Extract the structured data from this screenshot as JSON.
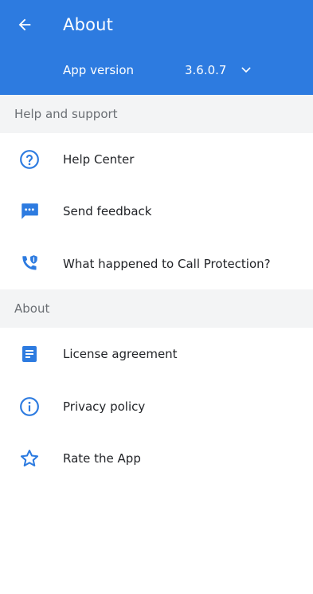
{
  "header": {
    "title": "About",
    "app_version_label": "App version",
    "app_version_value": "3.6.0.7"
  },
  "sections": [
    {
      "title": "Help and support",
      "items": [
        {
          "label": "Help Center",
          "icon": "help-circle-icon"
        },
        {
          "label": "Send feedback",
          "icon": "feedback-chat-icon"
        },
        {
          "label": "What happened to Call Protection?",
          "icon": "call-protection-icon"
        }
      ]
    },
    {
      "title": "About",
      "items": [
        {
          "label": "License agreement",
          "icon": "document-icon"
        },
        {
          "label": "Privacy policy",
          "icon": "info-icon"
        },
        {
          "label": "Rate the App",
          "icon": "star-icon"
        }
      ]
    }
  ],
  "colors": {
    "header_bg": "#2d7be0",
    "accent_icon": "#2d7be0",
    "section_bg": "#f3f4f5"
  }
}
